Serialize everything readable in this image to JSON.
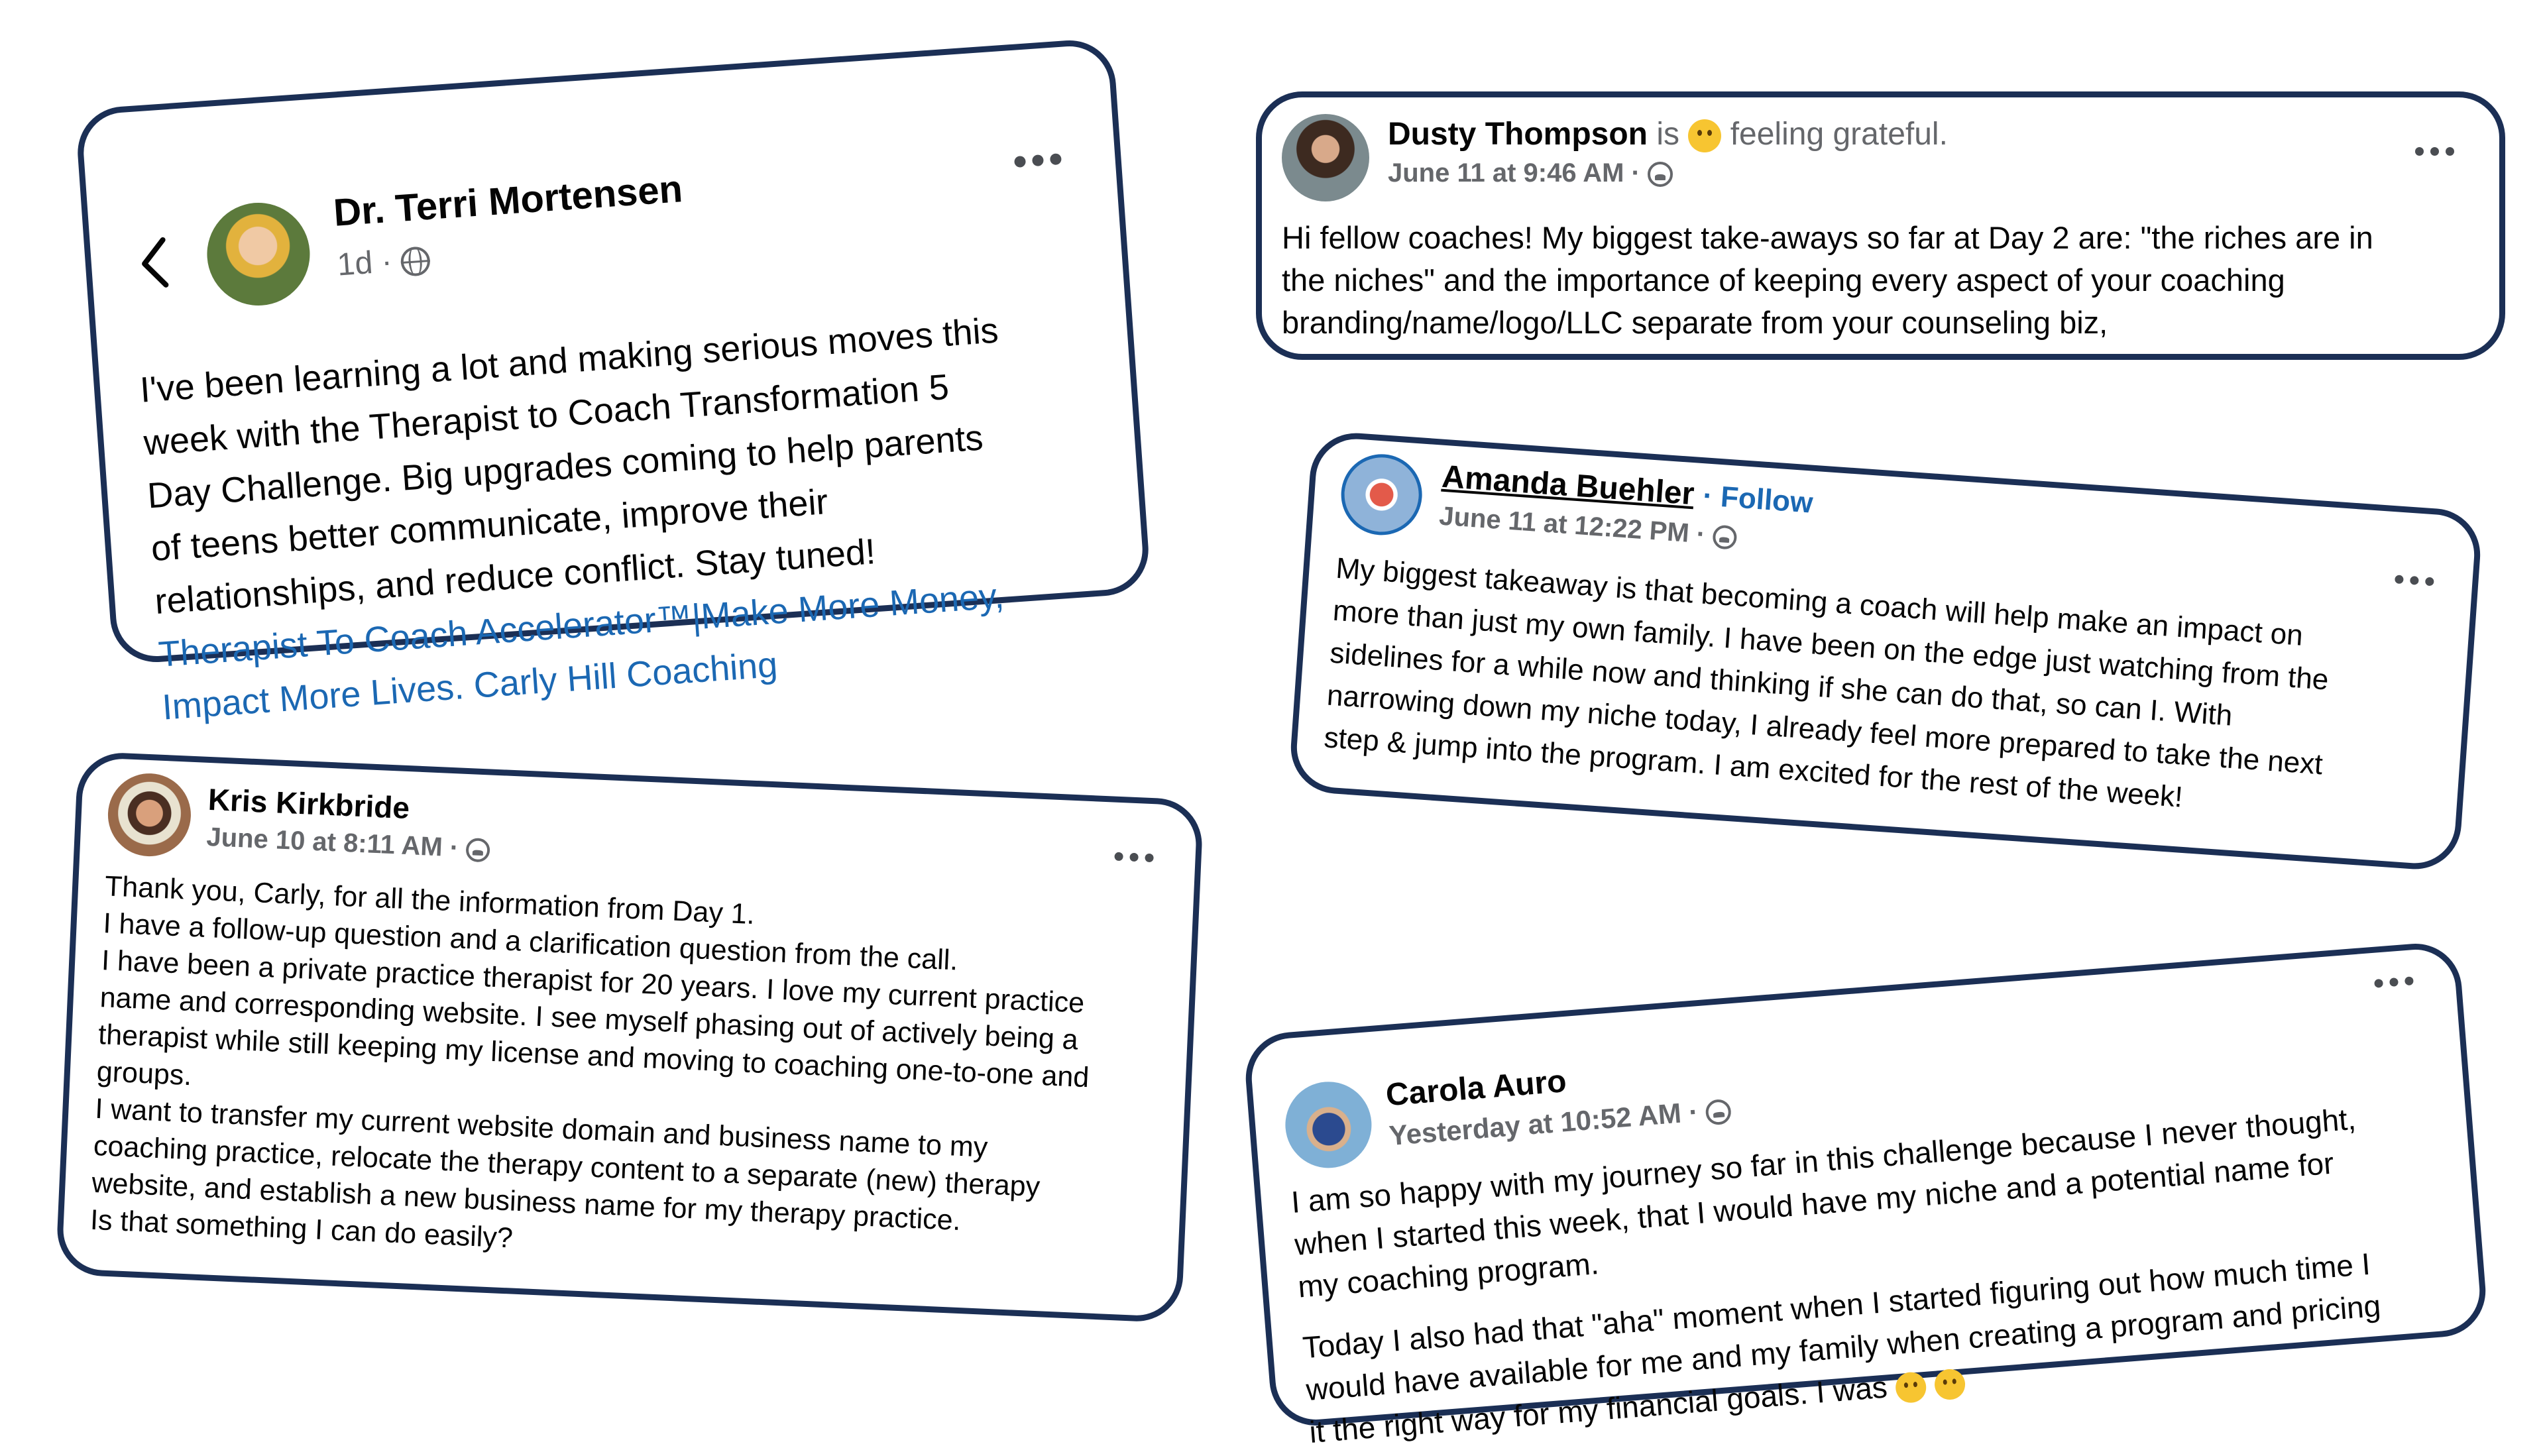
{
  "posts": {
    "terri": {
      "name": "Dr. Terri Mortensen",
      "time": "1d ·",
      "lines": [
        "I've been learning a lot and making serious moves this",
        "week with the Therapist to Coach Transformation 5",
        "Day Challenge. Big upgrades coming to help parents",
        "of teens better communicate, improve their",
        "relationships, and reduce conflict. Stay tuned!"
      ],
      "link_lines": [
        "Therapist To Coach Accelerator™|Make More Money,",
        "Impact More Lives. Carly Hill Coaching"
      ],
      "icons": [
        "back-arrow-icon",
        "globe-icon",
        "more-options-icon"
      ]
    },
    "dusty": {
      "name": "Dusty Thompson",
      "is": "is",
      "feeling": "feeling grateful.",
      "time": "June 11 at 9:46 AM ·",
      "lines": [
        "Hi fellow coaches! My biggest take-aways so far at Day 2 are: \"the riches are in",
        "the niches\" and the importance of keeping every aspect of your coaching",
        "branding/name/logo/LLC separate from your counseling biz,"
      ],
      "icons": [
        "grateful-emoji-icon",
        "group-icon",
        "more-options-icon"
      ]
    },
    "amanda": {
      "name": "Amanda Buehler",
      "follow": "· Follow",
      "time": "June 11 at 12:22 PM ·",
      "lines": [
        "My biggest takeaway is that becoming a coach will help make an impact on",
        "more than just my own family. I have been on the edge just watching from the",
        "sidelines for a while now and thinking if she can do that, so can I. With",
        "narrowing down my niche today, I already feel more prepared to take the next",
        "step & jump into the program. I am excited for the rest of the week!"
      ],
      "icons": [
        "group-icon",
        "more-options-icon"
      ]
    },
    "kris": {
      "name": "Kris Kirkbride",
      "time": "June 10 at 8:11 AM ·",
      "lines": [
        "Thank you, Carly, for all the information from Day 1.",
        "I have a follow-up question and a clarification question from the call.",
        "I have been a private practice therapist for 20 years. I love my current practice",
        "name and corresponding website. I see myself phasing out of actively being a",
        "therapist while still keeping my license and moving to coaching one-to-one and",
        "groups.",
        "I want to transfer my current website domain and business name to my",
        "coaching practice, relocate the therapy content to a separate (new) therapy",
        "website, and establish a new business name for my therapy practice.",
        "Is that something I can do easily?"
      ],
      "icons": [
        "group-icon",
        "more-options-icon"
      ]
    },
    "carola": {
      "name": "Carola Auro",
      "time": "Yesterday at 10:52 AM ·",
      "lines": [
        "I am so happy with my journey so far in this challenge because I never thought,",
        "when I started this week, that I would have my niche and a potential name for",
        "my coaching program."
      ],
      "lines2": [
        "Today I also had that \"aha\" moment when I started figuring out how much time I",
        "would have available for me and my family when creating a program and pricing",
        "it the right way for my financial goals. I was"
      ],
      "icons": [
        "group-icon",
        "mind-blown-emoji-icon",
        "smiling-emoji-icon",
        "more-options-icon"
      ]
    }
  },
  "colors": {
    "border": "#1b2f55",
    "link": "#1b68b3",
    "meta": "#65676b"
  }
}
